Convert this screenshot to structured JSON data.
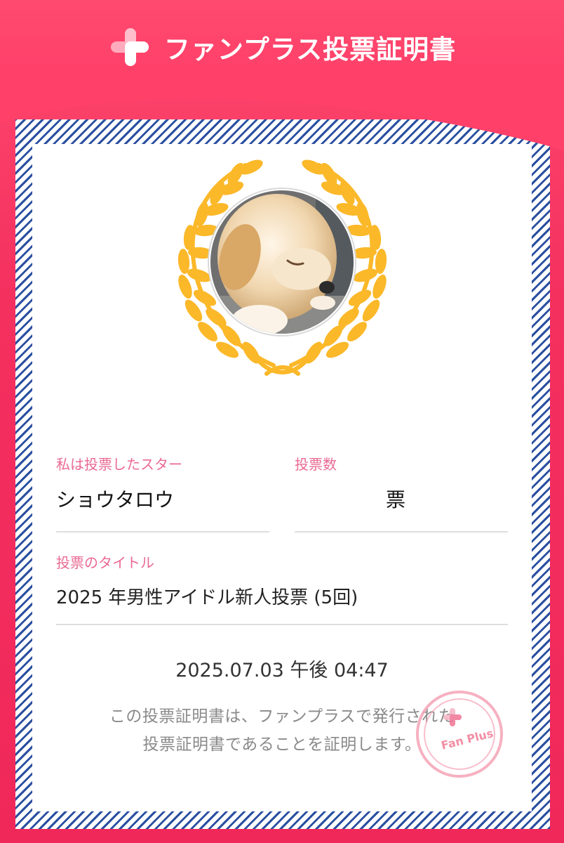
{
  "header": {
    "title": "ファンプラス投票証明書",
    "logo_icon": "fanplus-plus-logo-icon",
    "brand_color": "#ff4a6f"
  },
  "certificate": {
    "star_label": "私は投票したスター",
    "star_name": "ショウタロウ",
    "votes_label": "投票数",
    "votes_value": "票",
    "title_label": "投票のタイトル",
    "title_value": "2025 年男性アイドル新人投票 (5回)",
    "datetime": "2025.07.03 午後 04:47",
    "note_line1": "この投票証明書は、ファンプラスで発行された",
    "note_line2": "投票証明書であることを証明します。",
    "stamp_text": "Fan Plus",
    "label_color": "#ea6a93",
    "wreath_color": "#fbb829",
    "stripe_color": "#2a4fa0"
  }
}
